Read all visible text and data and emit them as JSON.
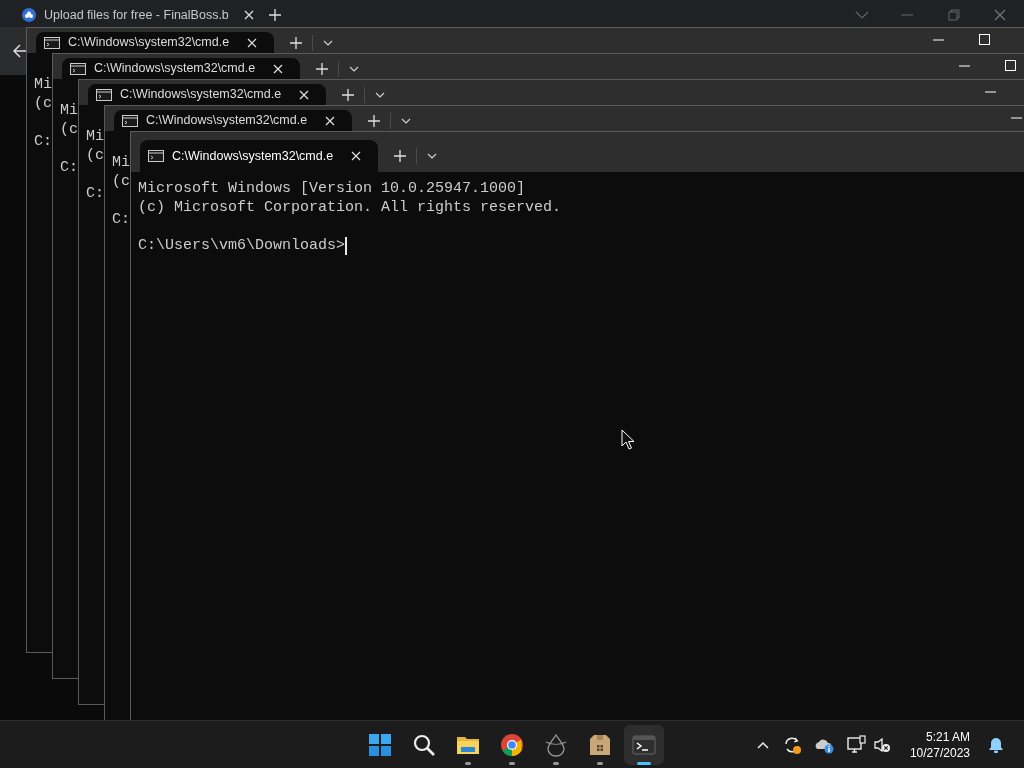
{
  "browser": {
    "tab_title": "Upload files for free - FinalBoss.b"
  },
  "terminals": [
    {
      "tab_title": "C:\\Windows\\system32\\cmd.e",
      "lines": [
        "Mi",
        "(c"
      ],
      "prompt": "C:"
    },
    {
      "tab_title": "C:\\Windows\\system32\\cmd.e",
      "lines": [
        "Mi",
        "(c"
      ],
      "prompt": "C:"
    },
    {
      "tab_title": "C:\\Windows\\system32\\cmd.e",
      "lines": [
        "Mi",
        "(c"
      ],
      "prompt": "C:"
    },
    {
      "tab_title": "C:\\Windows\\system32\\cmd.e",
      "lines": [
        "Mi",
        "(c"
      ],
      "prompt": "C:"
    },
    {
      "tab_title": "C:\\Windows\\system32\\cmd.e",
      "lines": [
        "Microsoft Windows [Version 10.0.25947.1000]",
        "(c) Microsoft Corporation. All rights reserved."
      ],
      "prompt": "C:\\Users\\vm6\\Downloads>",
      "cursor": true
    }
  ],
  "taskbar": {
    "apps": [
      {
        "kind": "start",
        "running": false,
        "selected": false
      },
      {
        "kind": "search",
        "running": false,
        "selected": false
      },
      {
        "kind": "folder",
        "running": true,
        "selected": false
      },
      {
        "kind": "chrome",
        "running": true,
        "selected": false
      },
      {
        "kind": "drop",
        "running": true,
        "selected": false
      },
      {
        "kind": "box",
        "running": true,
        "selected": false
      },
      {
        "kind": "terminal",
        "running": true,
        "selected": true
      }
    ],
    "clock": {
      "time": "5:21 AM",
      "date": "10/27/2023"
    }
  }
}
